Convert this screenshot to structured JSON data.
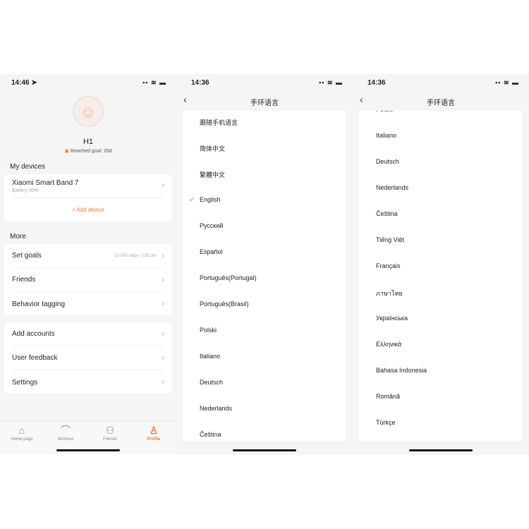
{
  "profile": {
    "time": "14:46 ➤",
    "name": "H1",
    "reached_goal": "Reached goal: 28d",
    "my_devices": "My devices",
    "device": {
      "name": "Xiaomi Smart Band 7",
      "battery": "Battery 69%"
    },
    "add_device": "+ Add device",
    "more": "More",
    "group1": [
      {
        "label": "Set goals",
        "value": "10,000 steps | 135 Jin"
      },
      {
        "label": "Friends",
        "value": ""
      },
      {
        "label": "Behavior tagging",
        "value": ""
      }
    ],
    "group2": [
      {
        "label": "Add accounts"
      },
      {
        "label": "User feedback"
      },
      {
        "label": "Settings"
      }
    ],
    "tabs": [
      {
        "label": "Home page",
        "icon": "home-icon"
      },
      {
        "label": "Workout",
        "icon": "shoe-icon"
      },
      {
        "label": "Friends",
        "icon": "friends-icon"
      },
      {
        "label": "Profile",
        "icon": "person-icon",
        "active": true
      }
    ],
    "accent": "#e8793a"
  },
  "lang1": {
    "time": "14:36",
    "title": "手环语言",
    "selected": "English",
    "items": [
      "跟随手机语言",
      "简体中文",
      "繁體中文",
      "English",
      "Русский",
      "Español",
      "Português(Portugal)",
      "Português(Brasil)",
      "Polski",
      "Italiano",
      "Deutsch",
      "Nederlands",
      "Čeština"
    ]
  },
  "lang2": {
    "time": "14:36",
    "title": "手环语言",
    "items": [
      "Polski",
      "Italiano",
      "Deutsch",
      "Nederlands",
      "Čeština",
      "Tiếng Việt",
      "Français",
      "ภาษาไทย",
      "Українська",
      "Ελληνικά",
      "Bahasa Indonesia",
      "Română",
      "Türkçe"
    ]
  }
}
